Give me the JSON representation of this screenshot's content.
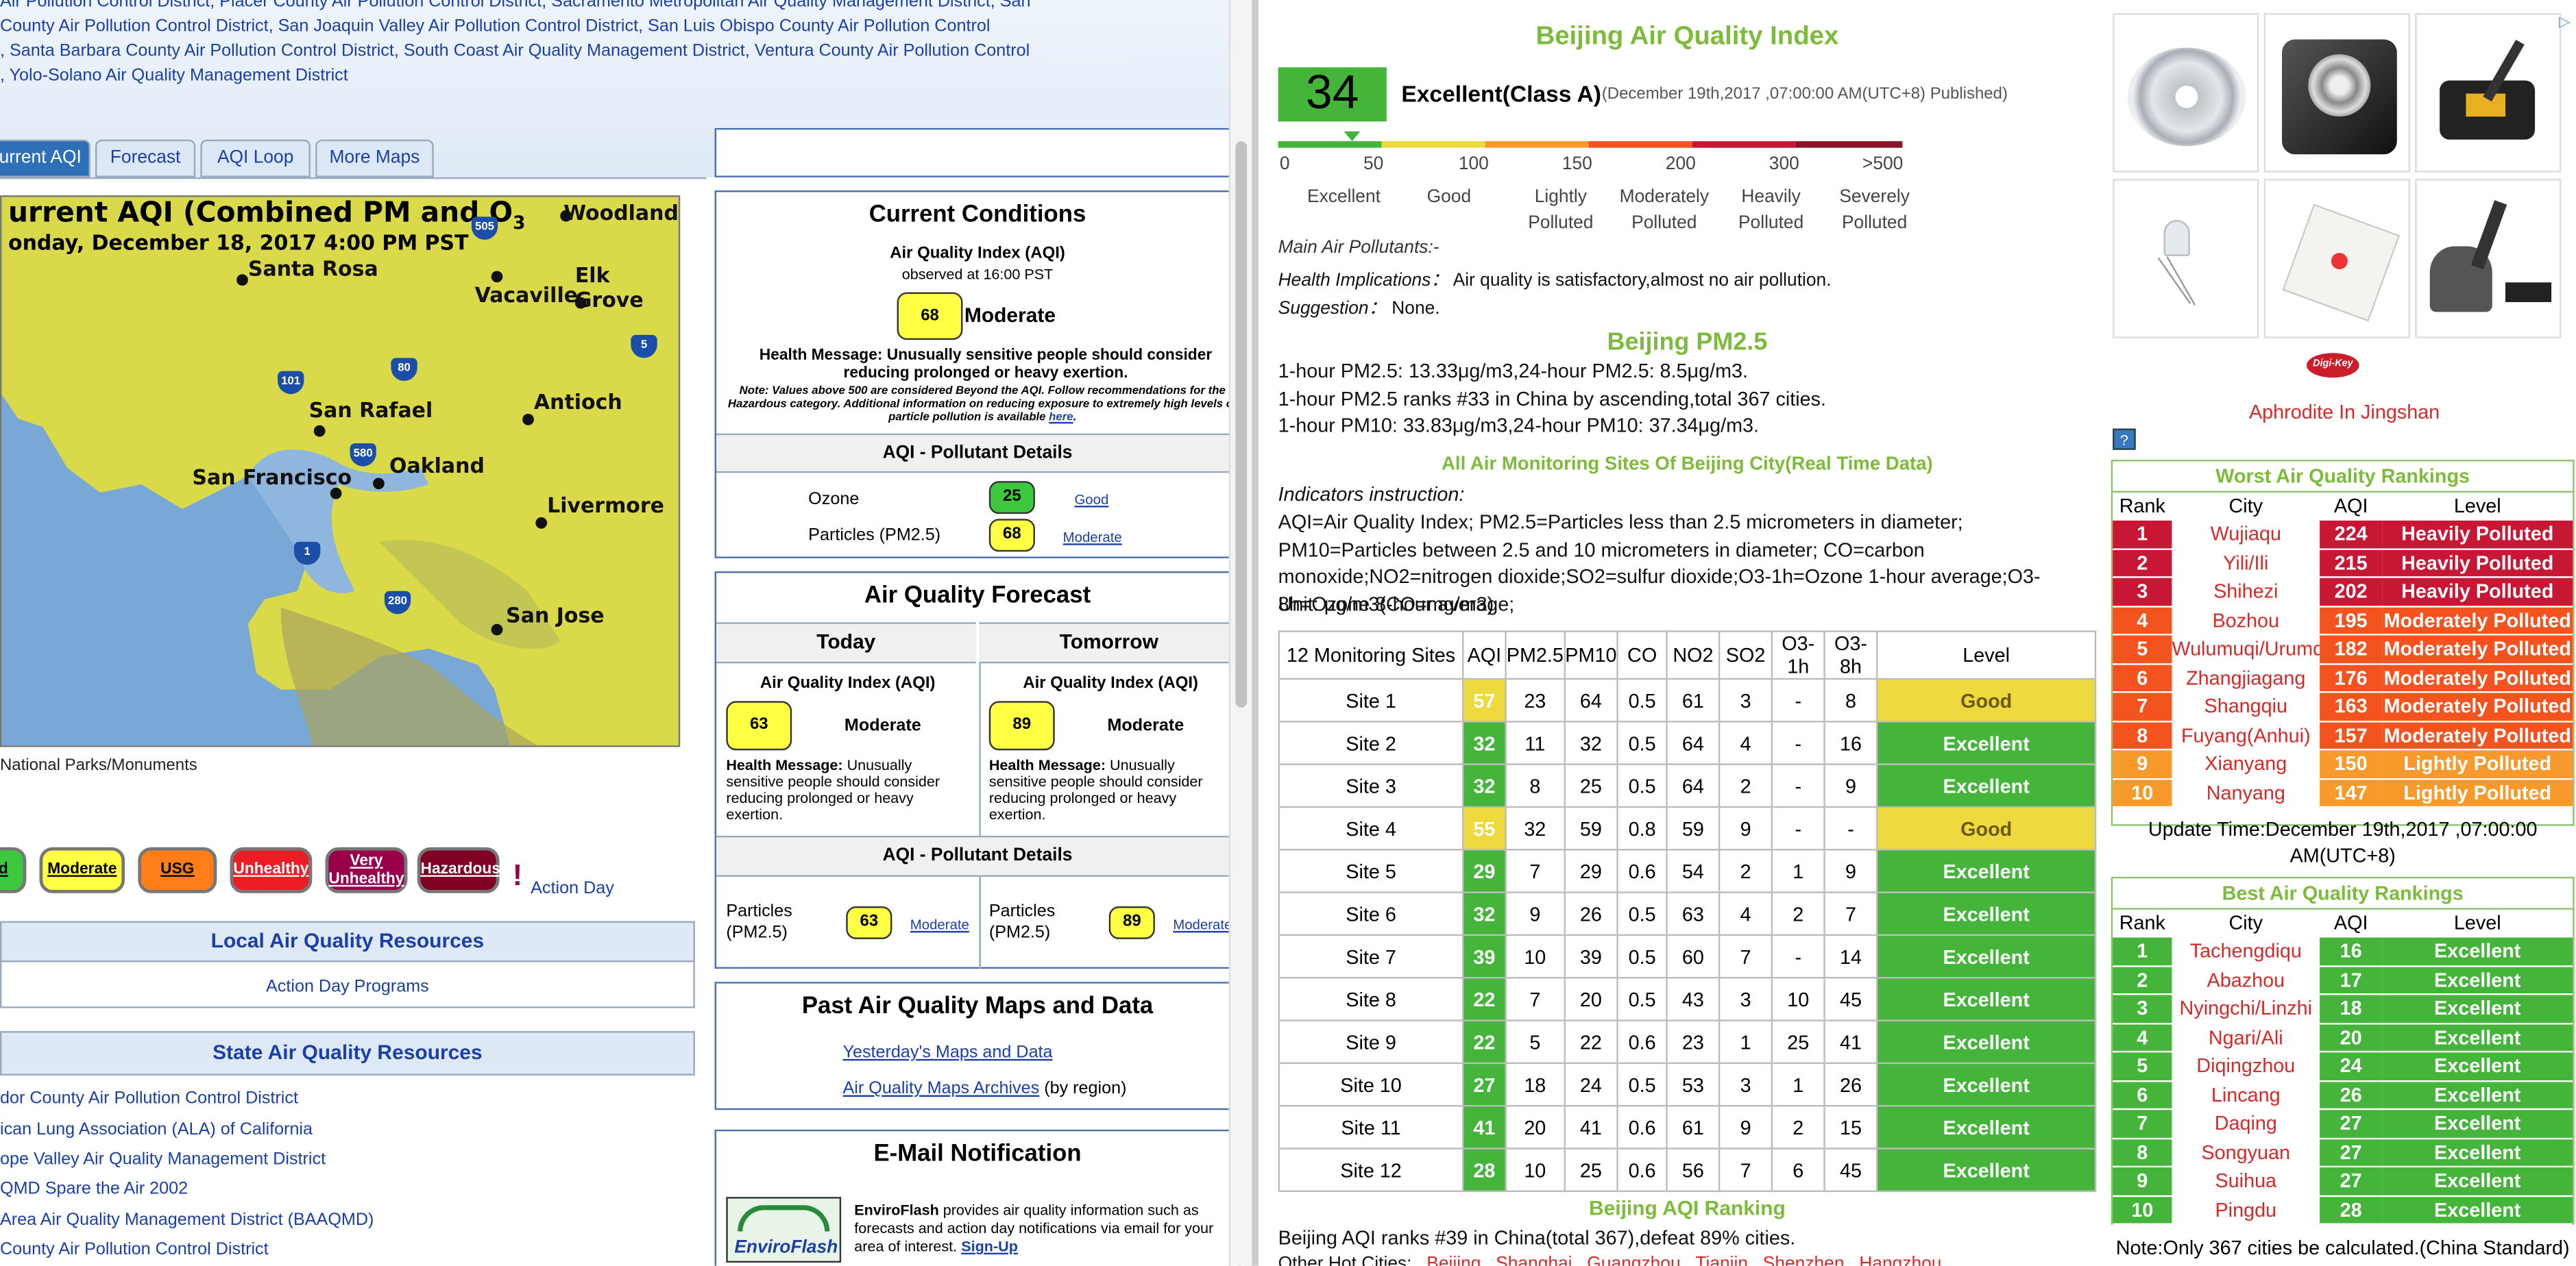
{
  "left": {
    "districts": [
      "Air Pollution Control District, Placer County Air Pollution Control District, Sacramento Metropolitan Air Quality Management District, San",
      "County Air Pollution Control District, San Joaquin Valley Air Pollution Control District, San Luis Obispo County Air Pollution Control",
      ", Santa Barbara County Air Pollution Control District, South Coast Air Quality Management District, Ventura County Air Pollution Control",
      ", Yolo-Solano Air Quality Management District"
    ],
    "tabs": [
      "urrent AQI",
      "Forecast",
      "AQI Loop",
      "More Maps"
    ],
    "map": {
      "title": "urrent AQI (Combined PM and O",
      "title_sup": "3",
      "subtitle": "onday, December 18, 2017 4:00 PM PST",
      "cities": [
        "Woodland",
        "Santa Rosa",
        "Elk Grove",
        "Vacaville",
        "San Rafael",
        "Antioch",
        "Oakland",
        "San Francisco",
        "Livermore",
        "San Jose"
      ],
      "footer": "National Parks/Monuments"
    },
    "scale_buttons": [
      "d",
      "Moderate",
      "USG",
      "Unhealthy",
      "Very Unhealthy",
      "Hazardous"
    ],
    "action_day": "Action Day",
    "local_header": "Local Air Quality Resources",
    "local_link": "Action Day Programs",
    "state_header": "State Air Quality Resources",
    "state_links": [
      "dor County Air Pollution Control District",
      "ican Lung Association (ALA) of California",
      "ope Valley Air Quality Management District",
      "QMD Spare the Air 2002",
      "Area Air Quality Management District (BAAQMD)",
      " County Air Pollution Control District"
    ],
    "current": {
      "title": "Current Conditions",
      "aqi_label": "Air Quality Index (AQI)",
      "observed": "observed at 16:00 PST",
      "aqi": "68",
      "aqi_cat": "Moderate",
      "health": "Health Message: Unusually sensitive people should consider reducing prolonged or heavy exertion.",
      "note": "Note: Values above 500 are considered Beyond the AQI. Follow recommendations for the Hazardous category. Additional information on reducing exposure to extremely high levels of particle pollution is available",
      "note_link": "here",
      "pollutant_header": "AQI - Pollutant Details",
      "pollutants": [
        {
          "name": "Ozone",
          "value": "25",
          "cat": "Good"
        },
        {
          "name": "Particles (PM2.5)",
          "value": "68",
          "cat": "Moderate"
        }
      ]
    },
    "forecast": {
      "title": "Air Quality Forecast",
      "days": [
        {
          "name": "Today",
          "aqi_label": "Air Quality Index (AQI)",
          "aqi": "63",
          "cat": "Moderate",
          "health_b": "Health Message:",
          "health": " Unusually sensitive people should consider reducing prolonged or heavy exertion.",
          "pm_label": "Particles (PM2.5)",
          "pm": "63",
          "pm_cat": "Moderate"
        },
        {
          "name": "Tomorrow",
          "aqi_label": "Air Quality Index (AQI)",
          "aqi": "89",
          "cat": "Moderate",
          "health_b": "Health Message:",
          "health": " Unusually sensitive people should consider reducing prolonged or heavy exertion.",
          "pm_label": "Particles (PM2.5)",
          "pm": "89",
          "pm_cat": "Moderate"
        }
      ],
      "pollutant_header": "AQI - Pollutant Details"
    },
    "past": {
      "title": "Past Air Quality Maps and Data",
      "link1": "Yesterday's Maps and Data",
      "link2": "Air Quality Maps Archives",
      "link2_suffix": " (by region)"
    },
    "email": {
      "title": "E-Mail Notification",
      "logo": "EnviroFlash",
      "text_b": "EnviroFlash",
      "text": " provides air quality information such as forecasts and action day notifications via email for your area of interest.",
      "signup": "Sign-Up"
    }
  },
  "right": {
    "title": "Beijing Air Quality Index",
    "aqi": "34",
    "aqi_class": "Excellent(Class A)",
    "published": "(December 19th,2017 ,07:00:00 AM(UTC+8) Published)",
    "scale_ticks": [
      "0",
      "50",
      "100",
      "150",
      "200",
      "300",
      ">500"
    ],
    "scale_labels": [
      "Excellent",
      "Good",
      "Lightly Polluted",
      "Moderately Polluted",
      "Heavily Polluted",
      "Severely Polluted"
    ],
    "main_pollutants": "Main Air Pollutants:-",
    "health_label": "Health Implications：",
    "health": "Air quality is satisfactory,almost no air pollution.",
    "suggestion_label": "Suggestion：",
    "suggestion": "None.",
    "pm_title": "Beijing PM2.5",
    "pm_lines": [
      "1-hour PM2.5: 13.33μg/m3,24-hour PM2.5: 8.5μg/m3.",
      "1-hour PM2.5 ranks #33 in China by ascending,total 367 cities.",
      "1-hour PM10: 33.83μg/m3,24-hour PM10: 37.34μg/m3."
    ],
    "sites_title": "All Air Monitoring Sites Of Beijing City(Real Time Data)",
    "indicators_title": "Indicators instruction:",
    "indicators_text": "AQI=Air Quality Index; PM2.5=Particles less than 2.5 micrometers in diameter; PM10=Particles between 2.5 and 10 micrometers in diameter; CO=carbon monoxide;NO2=nitrogen dioxide;SO2=sulfur dioxide;O3-1h=Ozone 1-hour average;O3-8h=Ozone 8-hour average;",
    "unit": "Unit: μg/m3(CO=mg/m3)",
    "table_headers": [
      "12 Monitoring Sites",
      "AQI",
      "PM2.5",
      "PM10",
      "CO",
      "NO2",
      "SO2",
      "O3-1h",
      "O3-8h",
      "Level"
    ],
    "sites": [
      [
        "Site 1",
        "57",
        "23",
        "64",
        "0.5",
        "61",
        "3",
        "-",
        "8",
        "Good"
      ],
      [
        "Site 2",
        "32",
        "11",
        "32",
        "0.5",
        "64",
        "4",
        "-",
        "16",
        "Excellent"
      ],
      [
        "Site 3",
        "32",
        "8",
        "25",
        "0.5",
        "64",
        "2",
        "-",
        "9",
        "Excellent"
      ],
      [
        "Site 4",
        "55",
        "32",
        "59",
        "0.8",
        "59",
        "9",
        "-",
        "-",
        "Good"
      ],
      [
        "Site 5",
        "29",
        "7",
        "29",
        "0.6",
        "54",
        "2",
        "1",
        "9",
        "Excellent"
      ],
      [
        "Site 6",
        "32",
        "9",
        "26",
        "0.5",
        "63",
        "4",
        "2",
        "7",
        "Excellent"
      ],
      [
        "Site 7",
        "39",
        "10",
        "39",
        "0.5",
        "60",
        "7",
        "-",
        "14",
        "Excellent"
      ],
      [
        "Site 8",
        "22",
        "7",
        "20",
        "0.5",
        "43",
        "3",
        "10",
        "45",
        "Excellent"
      ],
      [
        "Site 9",
        "22",
        "5",
        "22",
        "0.6",
        "23",
        "1",
        "25",
        "41",
        "Excellent"
      ],
      [
        "Site 10",
        "27",
        "18",
        "24",
        "0.5",
        "53",
        "3",
        "1",
        "26",
        "Excellent"
      ],
      [
        "Site 11",
        "41",
        "20",
        "41",
        "0.6",
        "61",
        "9",
        "2",
        "15",
        "Excellent"
      ],
      [
        "Site 12",
        "28",
        "10",
        "25",
        "0.6",
        "56",
        "7",
        "6",
        "45",
        "Excellent"
      ]
    ],
    "ranking_title": "Beijing AQI Ranking",
    "ranking_text": "Beijing AQI ranks #39 in China(total 367),defeat 89% cities.",
    "hot_label": "Other Hot Cities:",
    "hot_cities": [
      "Beijing",
      "Shanghai",
      "Guangzhou",
      "Tianjin",
      "Shenzhen",
      "Hangzhou"
    ],
    "sidebar": {
      "ad_label": "Aphrodite In Jingshan",
      "digikey": "Digi-Key",
      "info_icon": "?",
      "worst_title": "Worst Air Quality Rankings",
      "best_title": "Best Air Quality Rankings",
      "headers": [
        "Rank",
        "City",
        "AQI",
        "Level"
      ],
      "worst": [
        [
          "1",
          "Wujiaqu",
          "224",
          "Heavily Polluted"
        ],
        [
          "2",
          "Yili/Ili",
          "215",
          "Heavily Polluted"
        ],
        [
          "3",
          "Shihezi",
          "202",
          "Heavily Polluted"
        ],
        [
          "4",
          "Bozhou",
          "195",
          "Moderately Polluted"
        ],
        [
          "5",
          "Wulumuqi/Urumqi",
          "182",
          "Moderately Polluted"
        ],
        [
          "6",
          "Zhangjiagang",
          "176",
          "Moderately Polluted"
        ],
        [
          "7",
          "Shangqiu",
          "163",
          "Moderately Polluted"
        ],
        [
          "8",
          "Fuyang(Anhui)",
          "157",
          "Moderately Polluted"
        ],
        [
          "9",
          "Xianyang",
          "150",
          "Lightly Polluted"
        ],
        [
          "10",
          "Nanyang",
          "147",
          "Lightly Polluted"
        ]
      ],
      "update": "Update Time:December 19th,2017 ,07:00:00 AM(UTC+8)",
      "best": [
        [
          "1",
          "Tachengdiqu",
          "16",
          "Excellent"
        ],
        [
          "2",
          "Abazhou",
          "17",
          "Excellent"
        ],
        [
          "3",
          "Nyingchi/Linzhi",
          "18",
          "Excellent"
        ],
        [
          "4",
          "Ngari/Ali",
          "20",
          "Excellent"
        ],
        [
          "5",
          "Diqingzhou",
          "24",
          "Excellent"
        ],
        [
          "6",
          "Lincang",
          "26",
          "Excellent"
        ],
        [
          "7",
          "Daqing",
          "27",
          "Excellent"
        ],
        [
          "8",
          "Songyuan",
          "27",
          "Excellent"
        ],
        [
          "9",
          "Suihua",
          "27",
          "Excellent"
        ],
        [
          "10",
          "Pingdu",
          "28",
          "Excellent"
        ]
      ],
      "note": "Note:Only 367 cities be calculated.(China Standard)"
    },
    "colors": {
      "excellent": "#44b53a",
      "good": "#eed93f",
      "lightly": "#f79a2b",
      "moderately": "#f2531f",
      "heavily": "#c81734",
      "severely": "#8b1227",
      "accent_green": "#7dbb3b"
    }
  }
}
